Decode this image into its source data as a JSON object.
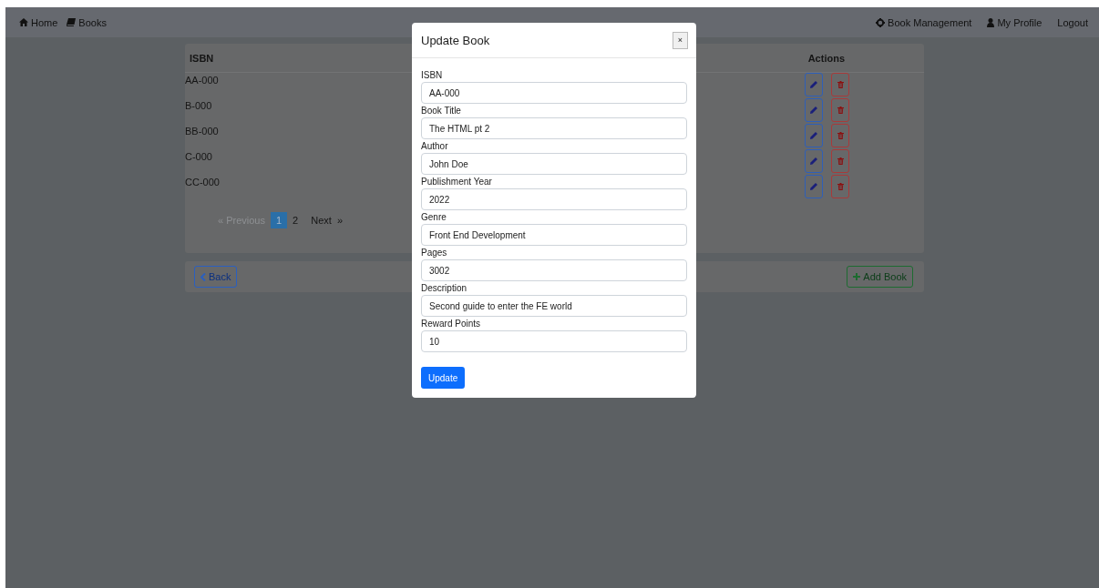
{
  "navbar": {
    "left": [
      {
        "label": "Home"
      },
      {
        "label": "Books"
      }
    ],
    "right": [
      {
        "label": "Book Management"
      },
      {
        "label": "My Profile"
      },
      {
        "label": "Logout"
      }
    ]
  },
  "table": {
    "columns": [
      "ISBN",
      "Actions"
    ],
    "rows": [
      {
        "isbn": "AA-000"
      },
      {
        "isbn": "B-000"
      },
      {
        "isbn": "BB-000"
      },
      {
        "isbn": "C-000"
      },
      {
        "isbn": "CC-000"
      }
    ]
  },
  "pagination": {
    "previous": {
      "label": "« Previous",
      "disabled": true
    },
    "pages": [
      {
        "label": "1",
        "selected": true
      },
      {
        "label": "2",
        "selected": false
      }
    ],
    "next": {
      "label": "Next",
      "arrow": "»",
      "disabled": false
    }
  },
  "footer": {
    "back": "Back",
    "add": "Add Book"
  },
  "modal": {
    "title": "Update Book",
    "close": "×",
    "fields": [
      {
        "label": "ISBN",
        "value": "AA-000"
      },
      {
        "label": "Book Title",
        "value": "The HTML pt 2"
      },
      {
        "label": "Author",
        "value": "John Doe"
      },
      {
        "label": "Publishment Year",
        "value": "2022"
      },
      {
        "label": "Genre",
        "value": "Front End Development"
      },
      {
        "label": "Pages",
        "value": "3002"
      },
      {
        "label": "Description",
        "value": "Second guide to enter the FE world"
      },
      {
        "label": "Reward Points",
        "value": "10"
      }
    ],
    "submit": "Update"
  }
}
